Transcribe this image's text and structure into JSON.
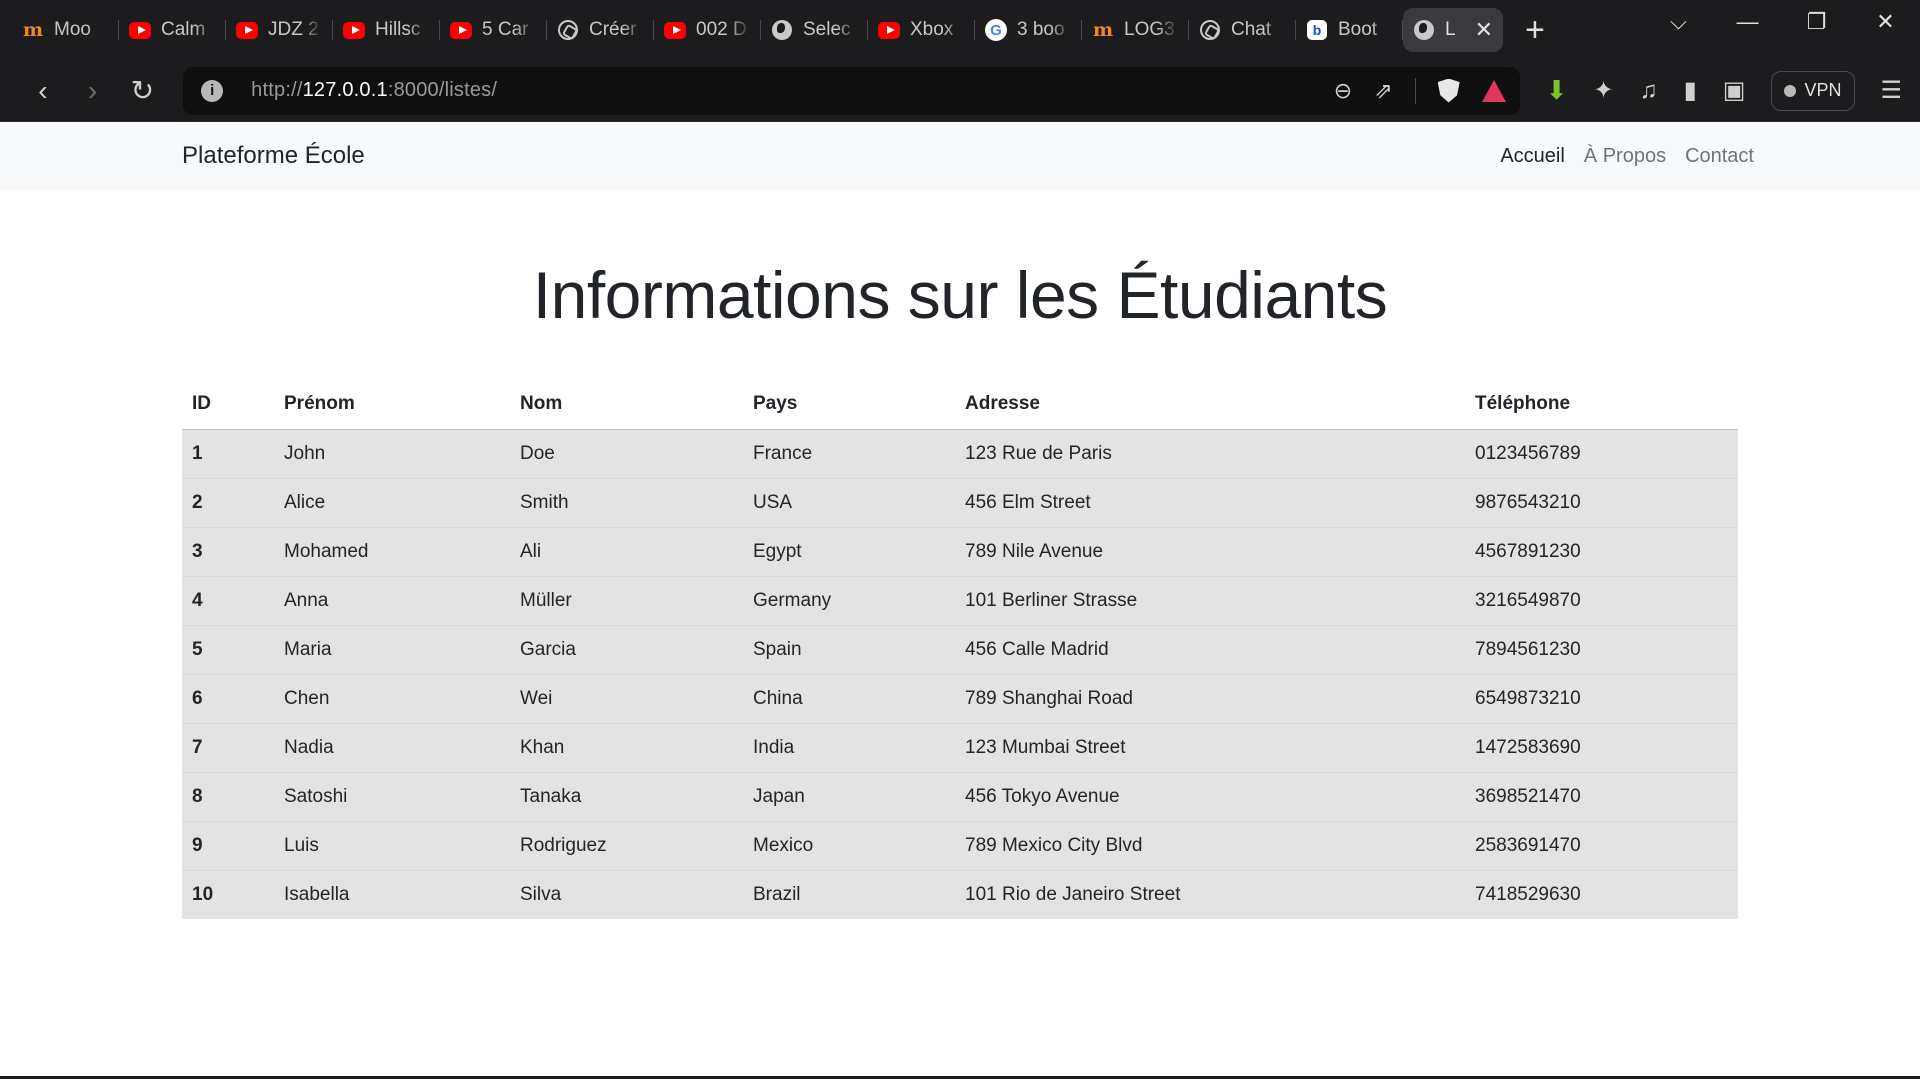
{
  "browser": {
    "tabs": [
      {
        "title": "Moo",
        "icon": "moodle-icon"
      },
      {
        "title": "Calm",
        "icon": "youtube-icon"
      },
      {
        "title": "JDZ 2",
        "icon": "youtube-icon"
      },
      {
        "title": "Hillsc",
        "icon": "youtube-icon"
      },
      {
        "title": "5 Car",
        "icon": "youtube-icon"
      },
      {
        "title": "Créer",
        "icon": "chatgpt-icon"
      },
      {
        "title": "002 D",
        "icon": "youtube-icon"
      },
      {
        "title": "Selec",
        "icon": "globe-icon"
      },
      {
        "title": "Xbox",
        "icon": "youtube-icon"
      },
      {
        "title": "3 boo",
        "icon": "google-icon"
      },
      {
        "title": "LOG3",
        "icon": "moodle-icon"
      },
      {
        "title": "Chat",
        "icon": "chatgpt-icon"
      },
      {
        "title": "Boot",
        "icon": "bootstrap-icon"
      },
      {
        "title": "L",
        "icon": "globe-icon",
        "active": true
      }
    ],
    "url_scheme": "http://",
    "url_host": "127.0.0.1",
    "url_rest": ":8000/listes/",
    "vpn_label": "VPN"
  },
  "site": {
    "brand": "Plateforme École",
    "nav": [
      {
        "label": "Accueil",
        "active": true
      },
      {
        "label": "À Propos",
        "active": false
      },
      {
        "label": "Contact",
        "active": false
      }
    ]
  },
  "main": {
    "title": "Informations sur les Étudiants",
    "table": {
      "headers": {
        "id": "ID",
        "prenom": "Prénom",
        "nom": "Nom",
        "pays": "Pays",
        "adresse": "Adresse",
        "telephone": "Téléphone"
      },
      "rows": [
        {
          "id": "1",
          "prenom": "John",
          "nom": "Doe",
          "pays": "France",
          "adresse": "123 Rue de Paris",
          "telephone": "0123456789"
        },
        {
          "id": "2",
          "prenom": "Alice",
          "nom": "Smith",
          "pays": "USA",
          "adresse": "456 Elm Street",
          "telephone": "9876543210"
        },
        {
          "id": "3",
          "prenom": "Mohamed",
          "nom": "Ali",
          "pays": "Egypt",
          "adresse": "789 Nile Avenue",
          "telephone": "4567891230"
        },
        {
          "id": "4",
          "prenom": "Anna",
          "nom": "Müller",
          "pays": "Germany",
          "adresse": "101 Berliner Strasse",
          "telephone": "3216549870"
        },
        {
          "id": "5",
          "prenom": "Maria",
          "nom": "Garcia",
          "pays": "Spain",
          "adresse": "456 Calle Madrid",
          "telephone": "7894561230"
        },
        {
          "id": "6",
          "prenom": "Chen",
          "nom": "Wei",
          "pays": "China",
          "adresse": "789 Shanghai Road",
          "telephone": "6549873210"
        },
        {
          "id": "7",
          "prenom": "Nadia",
          "nom": "Khan",
          "pays": "India",
          "adresse": "123 Mumbai Street",
          "telephone": "1472583690"
        },
        {
          "id": "8",
          "prenom": "Satoshi",
          "nom": "Tanaka",
          "pays": "Japan",
          "adresse": "456 Tokyo Avenue",
          "telephone": "3698521470"
        },
        {
          "id": "9",
          "prenom": "Luis",
          "nom": "Rodriguez",
          "pays": "Mexico",
          "adresse": "789 Mexico City Blvd",
          "telephone": "2583691470"
        },
        {
          "id": "10",
          "prenom": "Isabella",
          "nom": "Silva",
          "pays": "Brazil",
          "adresse": "101 Rio de Janeiro Street",
          "telephone": "7418529630"
        }
      ]
    }
  }
}
